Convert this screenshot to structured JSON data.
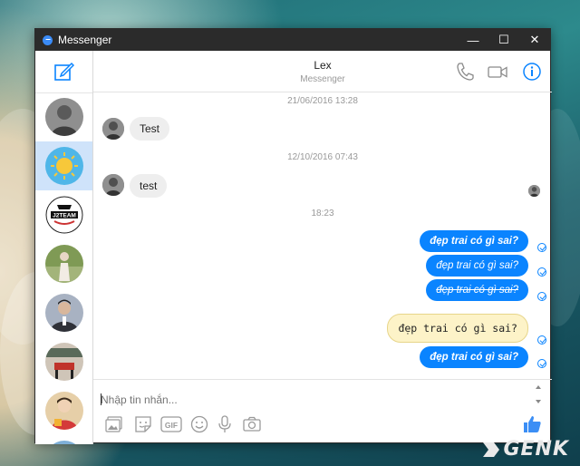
{
  "window": {
    "title": "Messenger",
    "controls": {
      "minimize": "—",
      "maximize": "☐",
      "close": "✕"
    }
  },
  "sidebar": {
    "items": [
      {
        "name": "contact-1",
        "colors": [
          "#9a9a9a",
          "#4a4a4a"
        ]
      },
      {
        "name": "contact-2-selected",
        "colors": [
          "#4fb6e8",
          "#f7c83a"
        ]
      },
      {
        "name": "contact-j2team",
        "colors": [
          "#ffffff",
          "#111111"
        ],
        "logo_text": "J2TEAM"
      },
      {
        "name": "contact-4",
        "colors": [
          "#6e8f4a",
          "#e8e0d6"
        ]
      },
      {
        "name": "contact-5",
        "colors": [
          "#9aa5b5",
          "#2f3138"
        ]
      },
      {
        "name": "contact-6",
        "colors": [
          "#cfc5b8",
          "#c0332b"
        ]
      },
      {
        "name": "contact-7",
        "colors": [
          "#e2c4a2",
          "#d43a3a"
        ]
      }
    ]
  },
  "header": {
    "name": "Lex",
    "subtitle": "Messenger"
  },
  "thread": {
    "timestamps": [
      "21/06/2016 13:28",
      "12/10/2016 07:43",
      "18:23"
    ],
    "incoming": [
      "Test",
      "test"
    ],
    "outgoing": [
      {
        "text": "đẹp trai có gì sai?",
        "style": "bold"
      },
      {
        "text": "đẹp trai có gì sai?",
        "style": "italic"
      },
      {
        "text": "đẹp trai có gì sai?",
        "style": "strike"
      },
      {
        "text": "đẹp trai có gì sai?",
        "style": "code"
      },
      {
        "text": "đẹp trai có gì sai?",
        "style": "bold"
      }
    ]
  },
  "composer": {
    "placeholder": "Nhập tin nhắn..."
  },
  "watermark": {
    "text": "GENK"
  },
  "colors": {
    "accent": "#0a84ff",
    "titlebar": "#2b2b2b",
    "selected": "#cfe3fa"
  }
}
